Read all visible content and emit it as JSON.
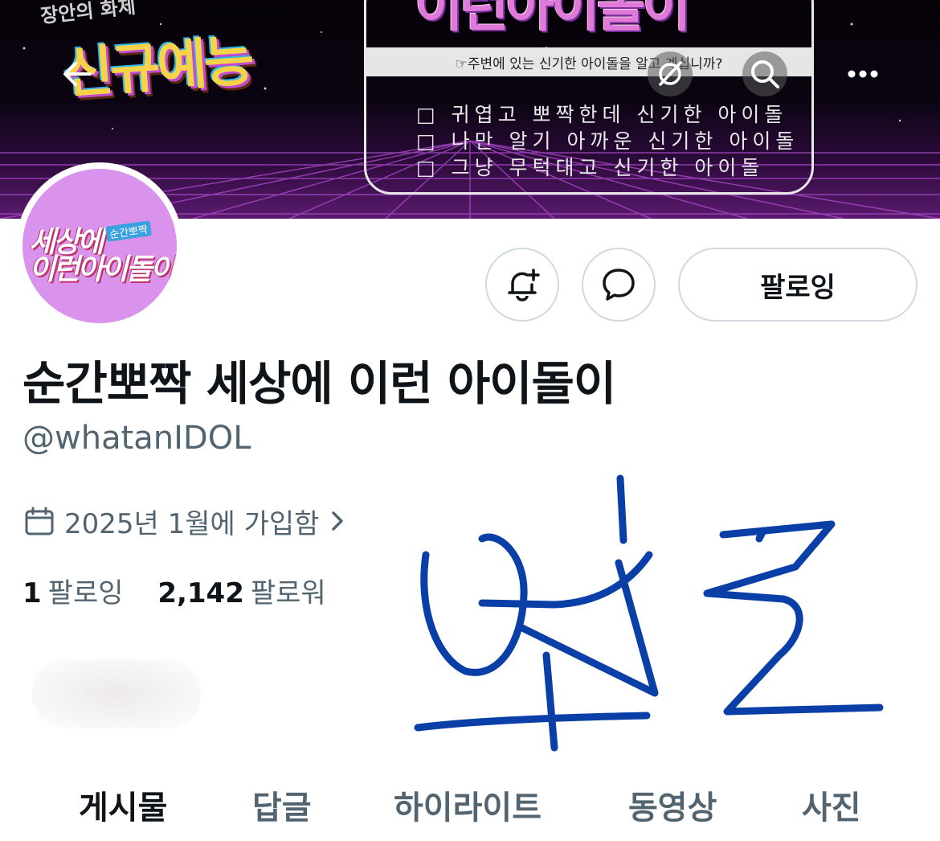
{
  "banner": {
    "logo_top": "장안의 화제",
    "logo": "신규예능",
    "notice_title": "이런아이돌이",
    "notice_bar": "☞주변에 있는 신기한 아이돌을 알고 계십니까?",
    "notice_lines": [
      "□ 귀엽고 뽀짝한데 신기한 아이돌",
      "□ 나만 알기 아까운 신기한 아이돌",
      "□ 그냥 무턱대고 신기한 아이돌"
    ]
  },
  "nav": {
    "back_icon": "arrow-left-icon",
    "grok_icon": "grok-slash-circle-icon",
    "search_icon": "search-icon",
    "more_icon": "more-dots-icon"
  },
  "avatar": {
    "line1": "세상에",
    "line2": "이런아이돌이",
    "tag": "순간뽀짝",
    "bg_color": "#d993ec"
  },
  "actions": {
    "notify_icon": "bell-plus-icon",
    "message_icon": "message-bubble-icon",
    "follow_label": "팔로잉"
  },
  "profile": {
    "name": "순간뽀짝 세상에 이런 아이돌이",
    "handle": "@whatanIDOL",
    "joined": "2025년 1월에 가입함",
    "following_count": "1",
    "following_label": "팔로잉",
    "followers_count": "2,142",
    "followers_label": "팔로워"
  },
  "annotation": {
    "handwriting": "보또",
    "color": "#0b3fa8"
  },
  "tabs": [
    {
      "label": "게시물",
      "active": true
    },
    {
      "label": "답글",
      "active": false
    },
    {
      "label": "하이라이트",
      "active": false
    },
    {
      "label": "동영상",
      "active": false
    },
    {
      "label": "사진",
      "active": false
    }
  ]
}
